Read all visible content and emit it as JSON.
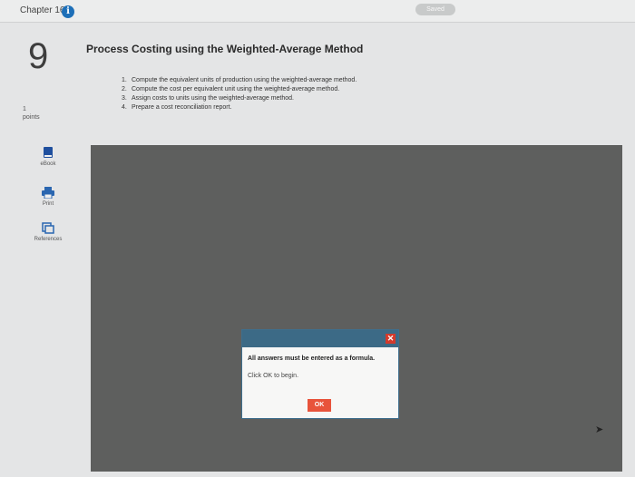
{
  "header": {
    "chapter_label": "Chapter 16",
    "info_icon": "info-icon",
    "saved_label": "Saved"
  },
  "question": {
    "number": "9",
    "points_value": "1",
    "points_label": "points",
    "title": "Process Costing using the Weighted-Average Method",
    "objectives": [
      {
        "num": "1.",
        "text": "Compute the equivalent units of production using the weighted-average method."
      },
      {
        "num": "2.",
        "text": "Compute the cost per equivalent unit using the weighted-average method."
      },
      {
        "num": "3.",
        "text": "Assign costs to units using the weighted-average method."
      },
      {
        "num": "4.",
        "text": "Prepare a cost reconciliation report."
      }
    ]
  },
  "sidebar": {
    "tools": [
      {
        "icon": "ebook-icon",
        "label": "eBook"
      },
      {
        "icon": "print-icon",
        "label": "Print"
      },
      {
        "icon": "references-icon",
        "label": "References"
      }
    ]
  },
  "dialog": {
    "message": "All answers must be entered as a formula.",
    "instruction": "Click OK to begin.",
    "ok_label": "OK",
    "close_icon": "close-icon"
  },
  "colors": {
    "info": "#1d6fb8",
    "dialog_header": "#3c6a86",
    "close": "#d33a2c",
    "ok": "#e8533b",
    "dark_area": "#5e5f5e"
  }
}
